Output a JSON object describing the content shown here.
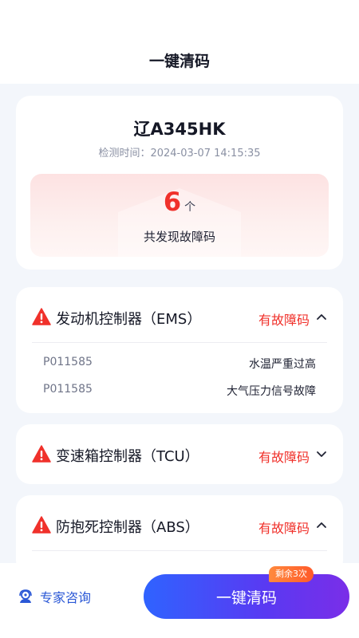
{
  "header": {
    "title": "一键清码"
  },
  "summary": {
    "plate": "辽A345HK",
    "check_time": "检测时间：2024-03-07 14:15:35",
    "fault_count": "6",
    "fault_unit": "个",
    "fault_caption": "共发现故障码"
  },
  "modules": [
    {
      "name": "发动机控制器（EMS）",
      "status": "有故障码",
      "expanded": true,
      "codes": [
        {
          "code": "P011585",
          "desc": "水温严重过高"
        },
        {
          "code": "P011585",
          "desc": "大气压力信号故障"
        }
      ]
    },
    {
      "name": "变速箱控制器（TCU）",
      "status": "有故障码",
      "expanded": false,
      "codes": []
    },
    {
      "name": "防抱死控制器（ABS）",
      "status": "有故障码",
      "expanded": true,
      "codes": []
    }
  ],
  "bottom": {
    "expert_label": "专家咨询",
    "clear_button": "一键清码",
    "remaining_badge": "剩余3次"
  },
  "colors": {
    "accent_red": "#f0312b",
    "button_start": "#2f63ff",
    "button_end": "#7a2ee8",
    "badge": "#ff6a30",
    "link_blue": "#2b58d6"
  },
  "icons": [
    "warning-icon",
    "chevron-up-icon",
    "chevron-down-icon",
    "headset-icon"
  ]
}
